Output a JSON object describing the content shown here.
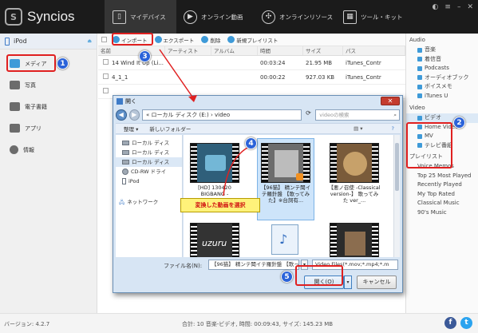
{
  "app": {
    "name": "Syncios"
  },
  "nav": {
    "tabs": [
      {
        "label": "マイデバイス",
        "icon": "phone-icon"
      },
      {
        "label": "オンライン動画",
        "icon": "play-icon"
      },
      {
        "label": "オンラインリソース",
        "icon": "globe-icon"
      },
      {
        "label": "ツール・キット",
        "icon": "grid-icon"
      }
    ],
    "active": 0
  },
  "sidebar": {
    "device": "iPod",
    "items": [
      {
        "label": "メディア",
        "icon": "media-icon"
      },
      {
        "label": "写真",
        "icon": "photo-icon"
      },
      {
        "label": "電子書籍",
        "icon": "book-icon"
      },
      {
        "label": "アプリ",
        "icon": "apps-icon"
      },
      {
        "label": "情報",
        "icon": "info-icon"
      }
    ]
  },
  "toolbar": {
    "import": "インポート",
    "export": "エクスポート",
    "delete": "削除",
    "new_playlist": "新規プレイリスト"
  },
  "table": {
    "columns": [
      "名前",
      "アーティスト",
      "アルバム",
      "時間",
      "サイズ",
      "パス"
    ],
    "rows": [
      {
        "name": "14 Wind It Up (Li...",
        "artist": "",
        "album": "",
        "time": "00:03:24",
        "size": "21.95 MB",
        "path": "iTunes_Contr"
      },
      {
        "name": "4_1_1",
        "artist": "",
        "album": "",
        "time": "00:00:22",
        "size": "927.03 KB",
        "path": "iTunes_Contr"
      },
      {
        "name": "",
        "artist": "",
        "album": "",
        "time": "",
        "size": "",
        "path": ""
      }
    ]
  },
  "right": {
    "audio_header": "Audio",
    "audio_items": [
      "音楽",
      "着信音",
      "Podcasts",
      "オーディオブック",
      "ボイスメモ",
      "iTunes U"
    ],
    "video_header": "Video",
    "video_items": [
      "ビデオ",
      "Home Videos",
      "MV",
      "テレビ番組"
    ],
    "playlist_header": "プレイリスト",
    "playlist_items": [
      "Voice Memos",
      "Top 25 Most Played",
      "Recently Played",
      "My Top Rated",
      "Classical Music",
      "90's Music"
    ]
  },
  "status": {
    "version": "バージョン: 4.2.7",
    "total": "合計: 10 音楽-ビデオ, 時間: 00:09:43, サイズ: 145.23 MB"
  },
  "dialog": {
    "title": "開く",
    "address": "« ローカル ディスク (E:) › video",
    "search_placeholder": "videoの検索",
    "organize": "整理 ▾",
    "new_folder": "新しいフォルダー",
    "nav_items": [
      "ローカル ディス",
      "ローカル ディス",
      "ローカル ディス",
      "CD-RW ドライ",
      "iPod",
      "ネットワーク"
    ],
    "files": [
      {
        "caption": "[HD] 130420 BIGBANG -"
      },
      {
        "caption": "【96猫】 精ンテ聞イテ羅針盤 【歌ってみた】※台詞有..."
      },
      {
        "caption": "【悪ノ召使 -Classical version-】 歌ってみた ver_..."
      },
      {
        "caption": ""
      },
      {
        "caption": ""
      },
      {
        "caption": ""
      }
    ],
    "filename_label": "ファイル名(N):",
    "filename_value": "【96猫】 精ンテ聞イテ羅針盤 【歌ってみた】",
    "filetype": "Video Files(*.mov;*.mp4;*.m",
    "open": "開く(O)",
    "cancel": "キャンセル"
  },
  "annotations": {
    "steps": [
      "1",
      "2",
      "3",
      "4",
      "5"
    ],
    "tip": "変換した動画を選択"
  }
}
